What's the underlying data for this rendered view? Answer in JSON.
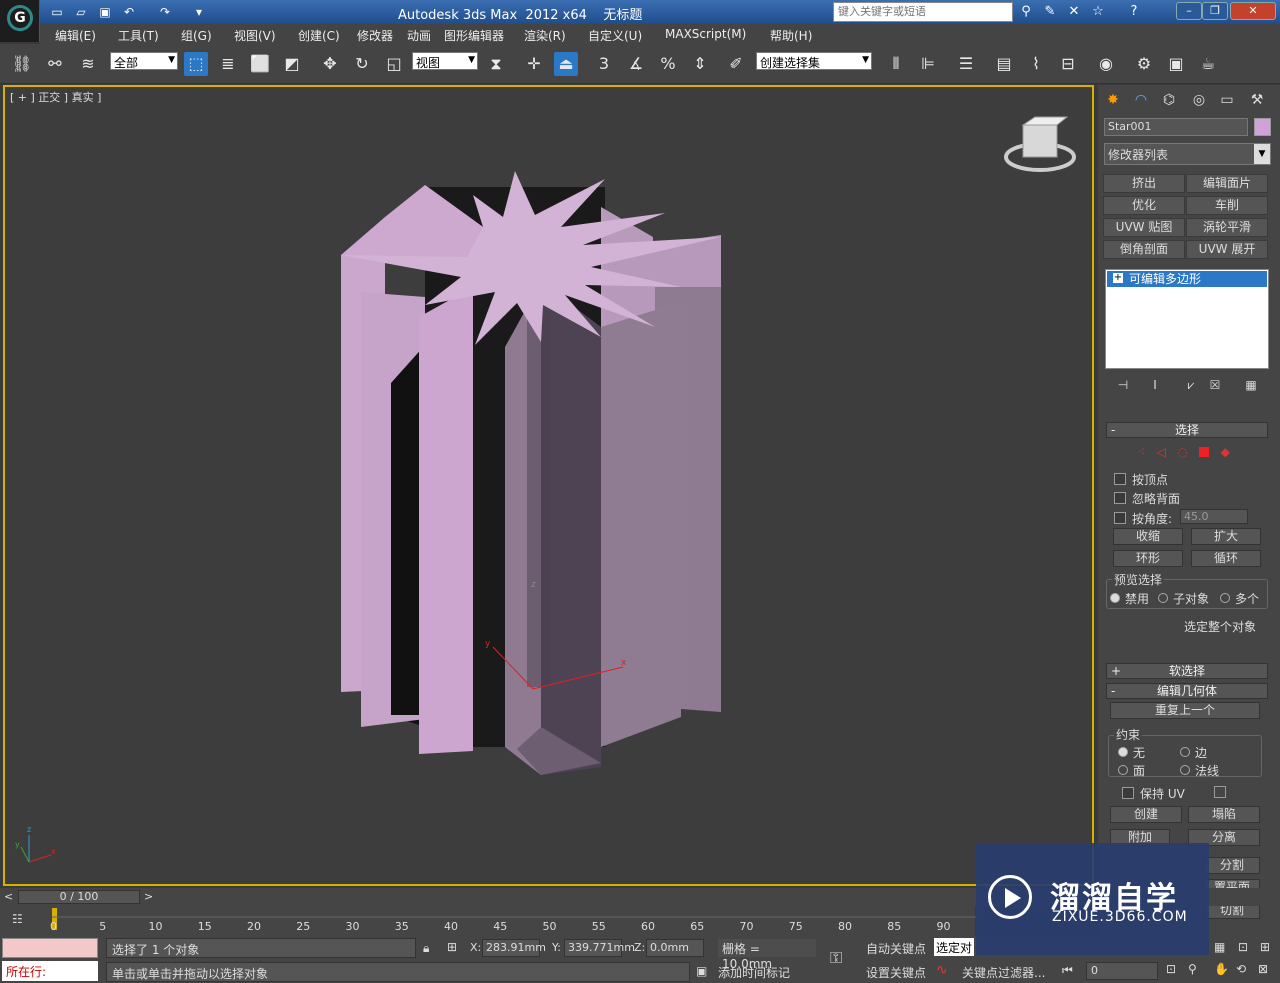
{
  "title": {
    "app": "Autodesk 3ds Max  2012 x64",
    "doc": "无标题",
    "search_placeholder": "键入关键字或短语"
  },
  "menu": [
    "编辑(E)",
    "工具(T)",
    "组(G)",
    "视图(V)",
    "创建(C)",
    "修改器",
    "动画",
    "图形编辑器",
    "渲染(R)",
    "自定义(U)",
    "MAXScript(M)",
    "帮助(H)"
  ],
  "toolbar": {
    "filter": "全部",
    "refcoord": "视图",
    "selset": "创建选择集",
    "snap_num": "3",
    "angle_sym": "%"
  },
  "viewport": {
    "label": "[ + ] 正交 ] 真实 ]",
    "axis": {
      "x": "x",
      "y": "y",
      "z": "z"
    },
    "mini_axis": {
      "x": "x",
      "y": "y",
      "z": "z"
    }
  },
  "panel": {
    "object_name": "Star001",
    "object_color": "#cda3d8",
    "modifier_list": "修改器列表",
    "mod_buttons": [
      "挤出",
      "编辑面片",
      "优化",
      "车削",
      "UVW 贴图",
      "涡轮平滑",
      "倒角剖面",
      "UVW 展开"
    ],
    "stack_item": "可编辑多边形",
    "selection": {
      "header": "选择",
      "by_vertex": "按顶点",
      "ignore_back": "忽略背面",
      "by_angle": "按角度:",
      "angle_value": "45.0",
      "shrink": "收缩",
      "grow": "扩大",
      "ring": "环形",
      "loop": "循环",
      "preview": "预览选择",
      "preview_off": "禁用",
      "preview_sub": "子对象",
      "preview_multi": "多个",
      "whole": "选定整个对象"
    },
    "soft_sel": "软选择",
    "edit_geo": {
      "header": "编辑几何体",
      "repeat": "重复上一个",
      "constraint": "约束",
      "none": "无",
      "edge": "边",
      "face": "面",
      "normal": "法线",
      "keep_uv": "保持 UV",
      "create": "创建",
      "collapse": "塌陷",
      "attach": "附加",
      "detach": "分离",
      "slice_partial": "分割",
      "slice_plane_partial": "置平面",
      "cut_partial": "切割"
    }
  },
  "time": {
    "frame": "0 / 100",
    "ticks": [
      "0",
      "5",
      "10",
      "15",
      "20",
      "25",
      "30",
      "35",
      "40",
      "45",
      "50",
      "55",
      "60",
      "65",
      "70",
      "75",
      "80",
      "85",
      "90"
    ]
  },
  "status": {
    "locale": "所在行:",
    "selected": "选择了 1 个对象",
    "prompt": "单击或单击并拖动以选择对象",
    "x_label": "X:",
    "x": "283.91mm",
    "y_label": "Y:",
    "y": "339.771mm",
    "z_label": "Z:",
    "z": "0.0mm",
    "grid": "栅格 = 10.0mm",
    "add_time": "添加时间标记",
    "auto_key": "自动关键点",
    "sel_obj": "选定对",
    "set_key": "设置关键点",
    "key_filter": "关键点过滤器...",
    "frame_num": "0"
  },
  "watermark": {
    "cn": "溜溜自学",
    "en": "ZIXUE.3D66.COM"
  }
}
